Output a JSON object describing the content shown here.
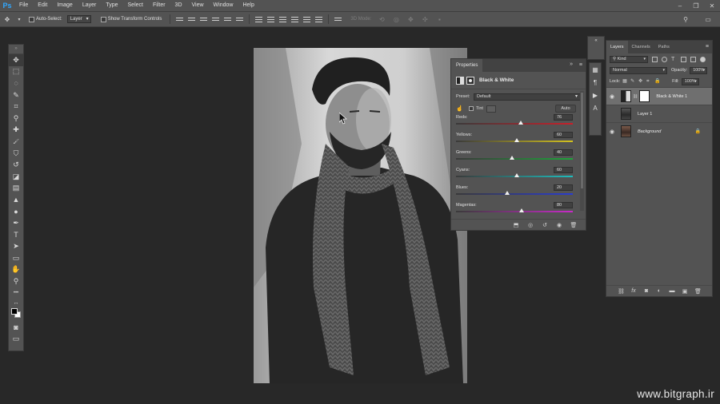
{
  "app": {
    "logo": "Ps"
  },
  "menubar": {
    "items": [
      "File",
      "Edit",
      "Image",
      "Layer",
      "Type",
      "Select",
      "Filter",
      "3D",
      "View",
      "Window",
      "Help"
    ],
    "window_controls": [
      "–",
      "❐",
      "✕"
    ]
  },
  "options_bar": {
    "auto_select_label": "Auto-Select:",
    "auto_select_target": "Layer",
    "show_transform_label": "Show Transform Controls",
    "mode_3d_label": "3D Mode:"
  },
  "tools": [
    {
      "name": "move-tool",
      "glyph": "✥"
    },
    {
      "name": "marquee-tool",
      "glyph": "⬚"
    },
    {
      "name": "lasso-tool",
      "glyph": "◌"
    },
    {
      "name": "quick-select-tool",
      "glyph": "✎"
    },
    {
      "name": "crop-tool",
      "glyph": "⌗"
    },
    {
      "name": "eyedropper-tool",
      "glyph": "⚲"
    },
    {
      "name": "healing-brush-tool",
      "glyph": "✚"
    },
    {
      "name": "brush-tool",
      "glyph": "🖌"
    },
    {
      "name": "clone-stamp-tool",
      "glyph": "⛉"
    },
    {
      "name": "history-brush-tool",
      "glyph": "↺"
    },
    {
      "name": "eraser-tool",
      "glyph": "◪"
    },
    {
      "name": "gradient-tool",
      "glyph": "▤"
    },
    {
      "name": "blur-tool",
      "glyph": "▲"
    },
    {
      "name": "dodge-tool",
      "glyph": "●"
    },
    {
      "name": "pen-tool",
      "glyph": "✒"
    },
    {
      "name": "type-tool",
      "glyph": "T"
    },
    {
      "name": "path-select-tool",
      "glyph": "➤"
    },
    {
      "name": "shape-tool",
      "glyph": "▭"
    },
    {
      "name": "hand-tool",
      "glyph": "✋"
    },
    {
      "name": "zoom-tool",
      "glyph": "⚲"
    },
    {
      "name": "more-tools",
      "glyph": "•••"
    }
  ],
  "properties": {
    "tab": "Properties",
    "title": "Black & White",
    "preset_label": "Preset:",
    "preset_value": "Default",
    "tint_label": "Tint",
    "auto_label": "Auto",
    "sliders": [
      {
        "label": "Reds:",
        "value": "76",
        "level": 76,
        "from": "#c8202a",
        "to": "#c8202a"
      },
      {
        "label": "Yellows:",
        "value": "60",
        "level": 60,
        "from": "#d4c21e",
        "to": "#d4c21e"
      },
      {
        "label": "Greens:",
        "value": "40",
        "level": 40,
        "from": "#1ea43a",
        "to": "#1ea43a"
      },
      {
        "label": "Cyans:",
        "value": "60",
        "level": 60,
        "from": "#1ebcbc",
        "to": "#1ebcbc"
      },
      {
        "label": "Blues:",
        "value": "20",
        "level": 20,
        "from": "#2a3ccf",
        "to": "#2a3ccf"
      },
      {
        "label": "Magentas:",
        "value": "80",
        "level": 80,
        "from": "#c82ac8",
        "to": "#c82ac8"
      }
    ]
  },
  "layers": {
    "tabs": [
      "Layers",
      "Channels",
      "Paths"
    ],
    "kind_label": "Kind",
    "blend_mode": "Normal",
    "opacity_label": "Opacity:",
    "opacity_value": "100%",
    "lock_label": "Lock:",
    "fill_label": "Fill:",
    "fill_value": "100%",
    "items": [
      {
        "name": "Black & White 1",
        "visible": true,
        "selected": true
      },
      {
        "name": "Layer 1",
        "visible": false,
        "selected": false
      },
      {
        "name": "Background",
        "visible": true,
        "selected": false,
        "italic": true
      }
    ]
  },
  "watermark": "www.bitgraph.ir"
}
